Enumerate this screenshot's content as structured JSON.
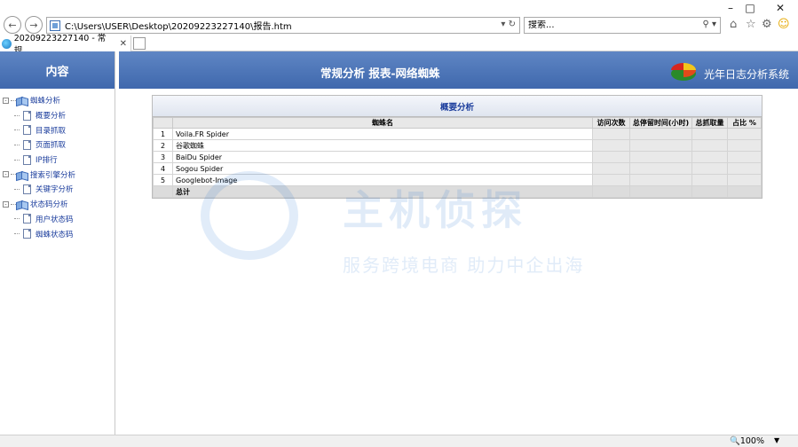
{
  "browser": {
    "url": "C:\\Users\\USER\\Desktop\\20209223227140\\报告.htm",
    "search_placeholder": "搜索...",
    "tab_title": "20209223227140 - 常规...",
    "zoom": "100%"
  },
  "left": {
    "header": "内容",
    "tree": [
      {
        "label": "蜘蛛分析",
        "level": 0
      },
      {
        "label": "概要分析",
        "level": 1
      },
      {
        "label": "目录抓取",
        "level": 1
      },
      {
        "label": "页面抓取",
        "level": 1
      },
      {
        "label": "IP排行",
        "level": 1
      },
      {
        "label": "搜索引擎分析",
        "level": 0
      },
      {
        "label": "关键字分析",
        "level": 1
      },
      {
        "label": "状态码分析",
        "level": 0
      },
      {
        "label": "用户状态码",
        "level": 1
      },
      {
        "label": "蜘蛛状态码",
        "level": 1
      }
    ]
  },
  "main": {
    "title": "常规分析 报表-网络蜘蛛",
    "brand": "光年日志分析系统",
    "summary": {
      "title": "概要分析",
      "columns": [
        "",
        "蜘蛛名",
        "访问次数",
        "总停留时间(小时)",
        "总抓取量",
        "占比 %"
      ],
      "rows": [
        {
          "idx": "1",
          "name": "Voila.FR Spider"
        },
        {
          "idx": "2",
          "name": "谷歌蜘蛛"
        },
        {
          "idx": "3",
          "name": "BaiDu Spider"
        },
        {
          "idx": "4",
          "name": "Sogou Spider"
        },
        {
          "idx": "5",
          "name": "Googlebot-Image"
        }
      ],
      "total_label": "总计"
    }
  },
  "watermark": {
    "text": "主机侦探",
    "sub": "服务跨境电商 助力中企出海"
  }
}
